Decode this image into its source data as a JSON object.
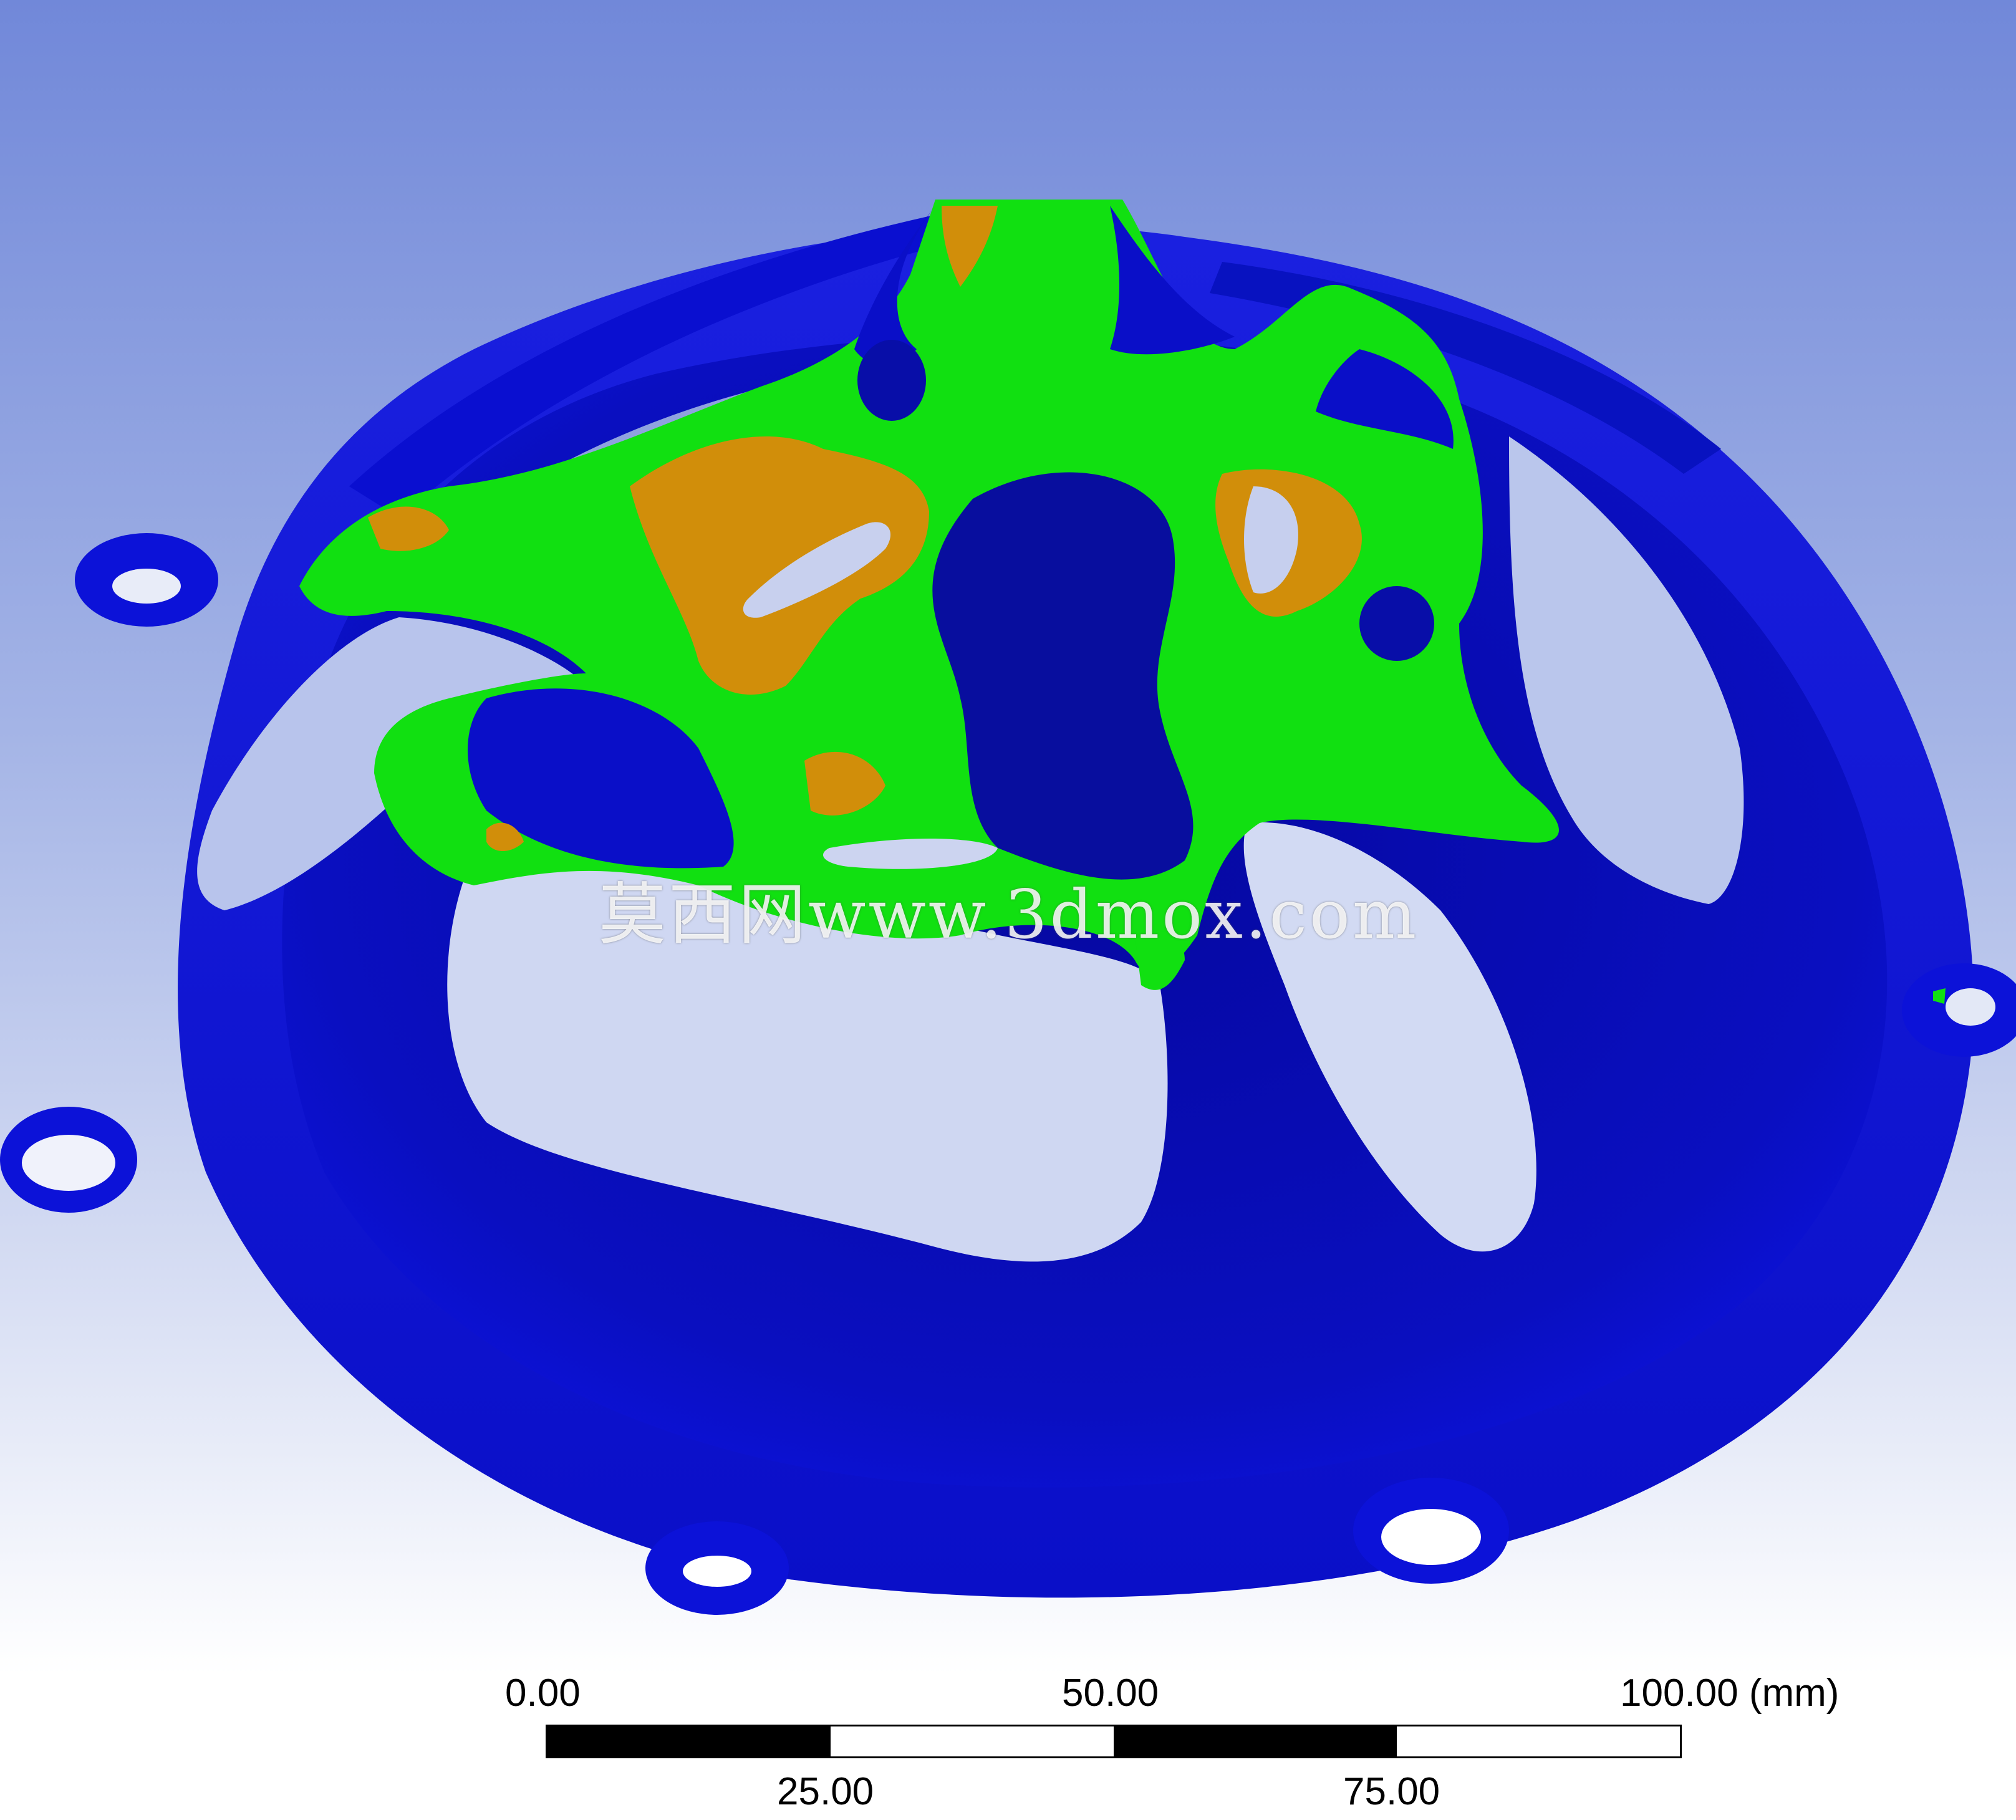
{
  "watermark": {
    "text": "莫西网www.3dmox.com"
  },
  "model": {
    "colors": {
      "blue_band": "#0a0fd0",
      "blue_dark": "#050a88",
      "green_band": "#11e011",
      "orange_band": "#d18e0a",
      "background_top": "#7188d9",
      "background_bottom": "#ffffff"
    }
  },
  "scale_bar": {
    "labels_top": [
      "0.00",
      "50.00",
      "100.00 (mm)"
    ],
    "labels_bottom": [
      "25.00",
      "75.00"
    ],
    "segments": [
      "black",
      "white",
      "black",
      "white"
    ]
  }
}
